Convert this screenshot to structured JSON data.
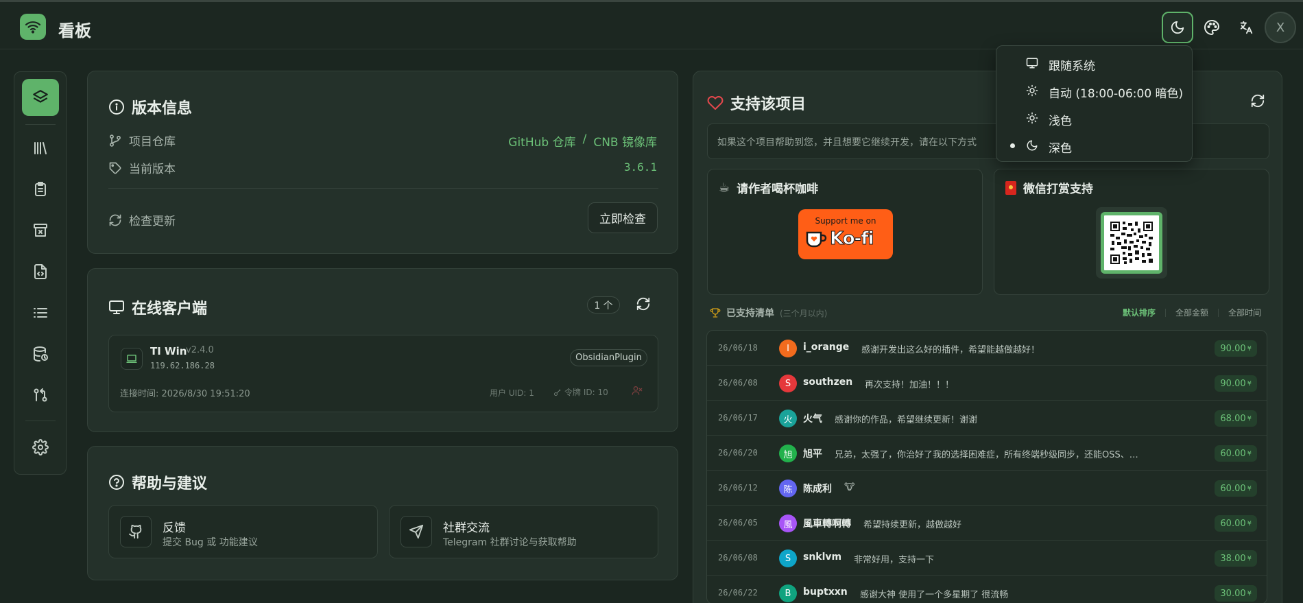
{
  "app": {
    "title": "看板",
    "avatar_initial": "X"
  },
  "theme_menu": {
    "items": [
      {
        "label": "跟随系统",
        "icon": "monitor-icon",
        "selected": false
      },
      {
        "label": "自动 (18:00-06:00 暗色)",
        "icon": "sun-icon",
        "selected": false
      },
      {
        "label": "浅色",
        "icon": "sun-icon",
        "selected": false
      },
      {
        "label": "深色",
        "icon": "moon-icon",
        "selected": true
      }
    ]
  },
  "version_card": {
    "title": "版本信息",
    "repo_label": "项目仓库",
    "repo_link_github": "GitHub 仓库",
    "repo_sep": "/",
    "repo_link_cnb": "CNB 镜像库",
    "version_label": "当前版本",
    "version_value": "3.6.1",
    "check_label": "检查更新",
    "check_button": "立即检查"
  },
  "clients_card": {
    "title": "在线客户端",
    "count": "1 个",
    "client": {
      "name": "TI Win",
      "version": "v2.4.0",
      "ip": "119.62.186.28",
      "tag": "ObsidianPlugin",
      "connected": "连接时间: 2026/8/30 19:51:20",
      "uid": "用户 UID: 1",
      "token": "令牌 ID: 10"
    }
  },
  "help_card": {
    "title": "帮助与建议",
    "feedback_title": "反馈",
    "feedback_desc": "提交 Bug 或 功能建议",
    "community_title": "社群交流",
    "community_desc": "Telegram 社群讨论与获取帮助"
  },
  "support_card": {
    "title": "支持该项目",
    "notice": "如果这个项目帮助到您，并且想要它继续开发，请在以下方式",
    "coffee_title": "请作者喝杯咖啡",
    "kofi_top": "Support me on",
    "kofi_brand": "Ko-fi",
    "wechat_title": "微信打赏支持",
    "list_title": "已支持清单",
    "list_sub": "(三个月以内)",
    "sort_default": "默认排序",
    "sort_amount": "全部金额",
    "sort_time": "全部时间",
    "currency": "¥",
    "rows": [
      {
        "date": "26/06/18",
        "initial": "I",
        "color": "#f26b1d",
        "name": "i_orange",
        "msg": "感谢开发出这么好的插件，希望能越做越好！",
        "amount": "90.00"
      },
      {
        "date": "26/06/08",
        "initial": "S",
        "color": "#e5383b",
        "name": "southzen",
        "msg": "再次支持！加油！！！",
        "amount": "90.00"
      },
      {
        "date": "26/06/17",
        "initial": "火",
        "color": "#1aa39a",
        "name": "火气",
        "msg": "感谢你的作品，希望继续更新！谢谢",
        "amount": "68.00"
      },
      {
        "date": "26/06/20",
        "initial": "旭",
        "color": "#22b14c",
        "name": "旭平",
        "msg": "兄弟，太强了，你治好了我的选择困难症，所有终端秒级同步，还能OSS、…",
        "amount": "60.00"
      },
      {
        "date": "26/06/12",
        "initial": "陈",
        "color": "#6366f1",
        "name": "陈成利",
        "msg": "🐮",
        "amount": "60.00"
      },
      {
        "date": "26/06/05",
        "initial": "風",
        "color": "#a855f7",
        "name": "風車轉啊轉",
        "msg": "希望持续更新，越做越好",
        "amount": "60.00"
      },
      {
        "date": "26/06/08",
        "initial": "S",
        "color": "#0ea5c9",
        "name": "snklvm",
        "msg": "非常好用，支持一下",
        "amount": "38.00"
      },
      {
        "date": "26/06/22",
        "initial": "B",
        "color": "#10a37f",
        "name": "buptxxn",
        "msg": "感谢大神 使用了一个多星期了 很流畅",
        "amount": "30.00"
      }
    ]
  },
  "colors": {
    "accent": "#5fb36a",
    "background": "#1b2620",
    "card": "#24312a",
    "kofi": "#ff5e16"
  }
}
